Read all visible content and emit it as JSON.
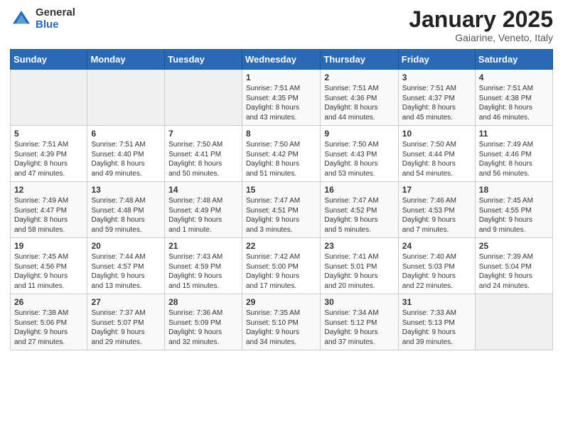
{
  "header": {
    "logo_general": "General",
    "logo_blue": "Blue",
    "month_year": "January 2025",
    "location": "Gaiarine, Veneto, Italy"
  },
  "weekdays": [
    "Sunday",
    "Monday",
    "Tuesday",
    "Wednesday",
    "Thursday",
    "Friday",
    "Saturday"
  ],
  "weeks": [
    [
      {
        "day": "",
        "info": ""
      },
      {
        "day": "",
        "info": ""
      },
      {
        "day": "",
        "info": ""
      },
      {
        "day": "1",
        "info": "Sunrise: 7:51 AM\nSunset: 4:35 PM\nDaylight: 8 hours\nand 43 minutes."
      },
      {
        "day": "2",
        "info": "Sunrise: 7:51 AM\nSunset: 4:36 PM\nDaylight: 8 hours\nand 44 minutes."
      },
      {
        "day": "3",
        "info": "Sunrise: 7:51 AM\nSunset: 4:37 PM\nDaylight: 8 hours\nand 45 minutes."
      },
      {
        "day": "4",
        "info": "Sunrise: 7:51 AM\nSunset: 4:38 PM\nDaylight: 8 hours\nand 46 minutes."
      }
    ],
    [
      {
        "day": "5",
        "info": "Sunrise: 7:51 AM\nSunset: 4:39 PM\nDaylight: 8 hours\nand 47 minutes."
      },
      {
        "day": "6",
        "info": "Sunrise: 7:51 AM\nSunset: 4:40 PM\nDaylight: 8 hours\nand 49 minutes."
      },
      {
        "day": "7",
        "info": "Sunrise: 7:50 AM\nSunset: 4:41 PM\nDaylight: 8 hours\nand 50 minutes."
      },
      {
        "day": "8",
        "info": "Sunrise: 7:50 AM\nSunset: 4:42 PM\nDaylight: 8 hours\nand 51 minutes."
      },
      {
        "day": "9",
        "info": "Sunrise: 7:50 AM\nSunset: 4:43 PM\nDaylight: 8 hours\nand 53 minutes."
      },
      {
        "day": "10",
        "info": "Sunrise: 7:50 AM\nSunset: 4:44 PM\nDaylight: 8 hours\nand 54 minutes."
      },
      {
        "day": "11",
        "info": "Sunrise: 7:49 AM\nSunset: 4:46 PM\nDaylight: 8 hours\nand 56 minutes."
      }
    ],
    [
      {
        "day": "12",
        "info": "Sunrise: 7:49 AM\nSunset: 4:47 PM\nDaylight: 8 hours\nand 58 minutes."
      },
      {
        "day": "13",
        "info": "Sunrise: 7:48 AM\nSunset: 4:48 PM\nDaylight: 8 hours\nand 59 minutes."
      },
      {
        "day": "14",
        "info": "Sunrise: 7:48 AM\nSunset: 4:49 PM\nDaylight: 9 hours\nand 1 minute."
      },
      {
        "day": "15",
        "info": "Sunrise: 7:47 AM\nSunset: 4:51 PM\nDaylight: 9 hours\nand 3 minutes."
      },
      {
        "day": "16",
        "info": "Sunrise: 7:47 AM\nSunset: 4:52 PM\nDaylight: 9 hours\nand 5 minutes."
      },
      {
        "day": "17",
        "info": "Sunrise: 7:46 AM\nSunset: 4:53 PM\nDaylight: 9 hours\nand 7 minutes."
      },
      {
        "day": "18",
        "info": "Sunrise: 7:45 AM\nSunset: 4:55 PM\nDaylight: 9 hours\nand 9 minutes."
      }
    ],
    [
      {
        "day": "19",
        "info": "Sunrise: 7:45 AM\nSunset: 4:56 PM\nDaylight: 9 hours\nand 11 minutes."
      },
      {
        "day": "20",
        "info": "Sunrise: 7:44 AM\nSunset: 4:57 PM\nDaylight: 9 hours\nand 13 minutes."
      },
      {
        "day": "21",
        "info": "Sunrise: 7:43 AM\nSunset: 4:59 PM\nDaylight: 9 hours\nand 15 minutes."
      },
      {
        "day": "22",
        "info": "Sunrise: 7:42 AM\nSunset: 5:00 PM\nDaylight: 9 hours\nand 17 minutes."
      },
      {
        "day": "23",
        "info": "Sunrise: 7:41 AM\nSunset: 5:01 PM\nDaylight: 9 hours\nand 20 minutes."
      },
      {
        "day": "24",
        "info": "Sunrise: 7:40 AM\nSunset: 5:03 PM\nDaylight: 9 hours\nand 22 minutes."
      },
      {
        "day": "25",
        "info": "Sunrise: 7:39 AM\nSunset: 5:04 PM\nDaylight: 9 hours\nand 24 minutes."
      }
    ],
    [
      {
        "day": "26",
        "info": "Sunrise: 7:38 AM\nSunset: 5:06 PM\nDaylight: 9 hours\nand 27 minutes."
      },
      {
        "day": "27",
        "info": "Sunrise: 7:37 AM\nSunset: 5:07 PM\nDaylight: 9 hours\nand 29 minutes."
      },
      {
        "day": "28",
        "info": "Sunrise: 7:36 AM\nSunset: 5:09 PM\nDaylight: 9 hours\nand 32 minutes."
      },
      {
        "day": "29",
        "info": "Sunrise: 7:35 AM\nSunset: 5:10 PM\nDaylight: 9 hours\nand 34 minutes."
      },
      {
        "day": "30",
        "info": "Sunrise: 7:34 AM\nSunset: 5:12 PM\nDaylight: 9 hours\nand 37 minutes."
      },
      {
        "day": "31",
        "info": "Sunrise: 7:33 AM\nSunset: 5:13 PM\nDaylight: 9 hours\nand 39 minutes."
      },
      {
        "day": "",
        "info": ""
      }
    ]
  ]
}
